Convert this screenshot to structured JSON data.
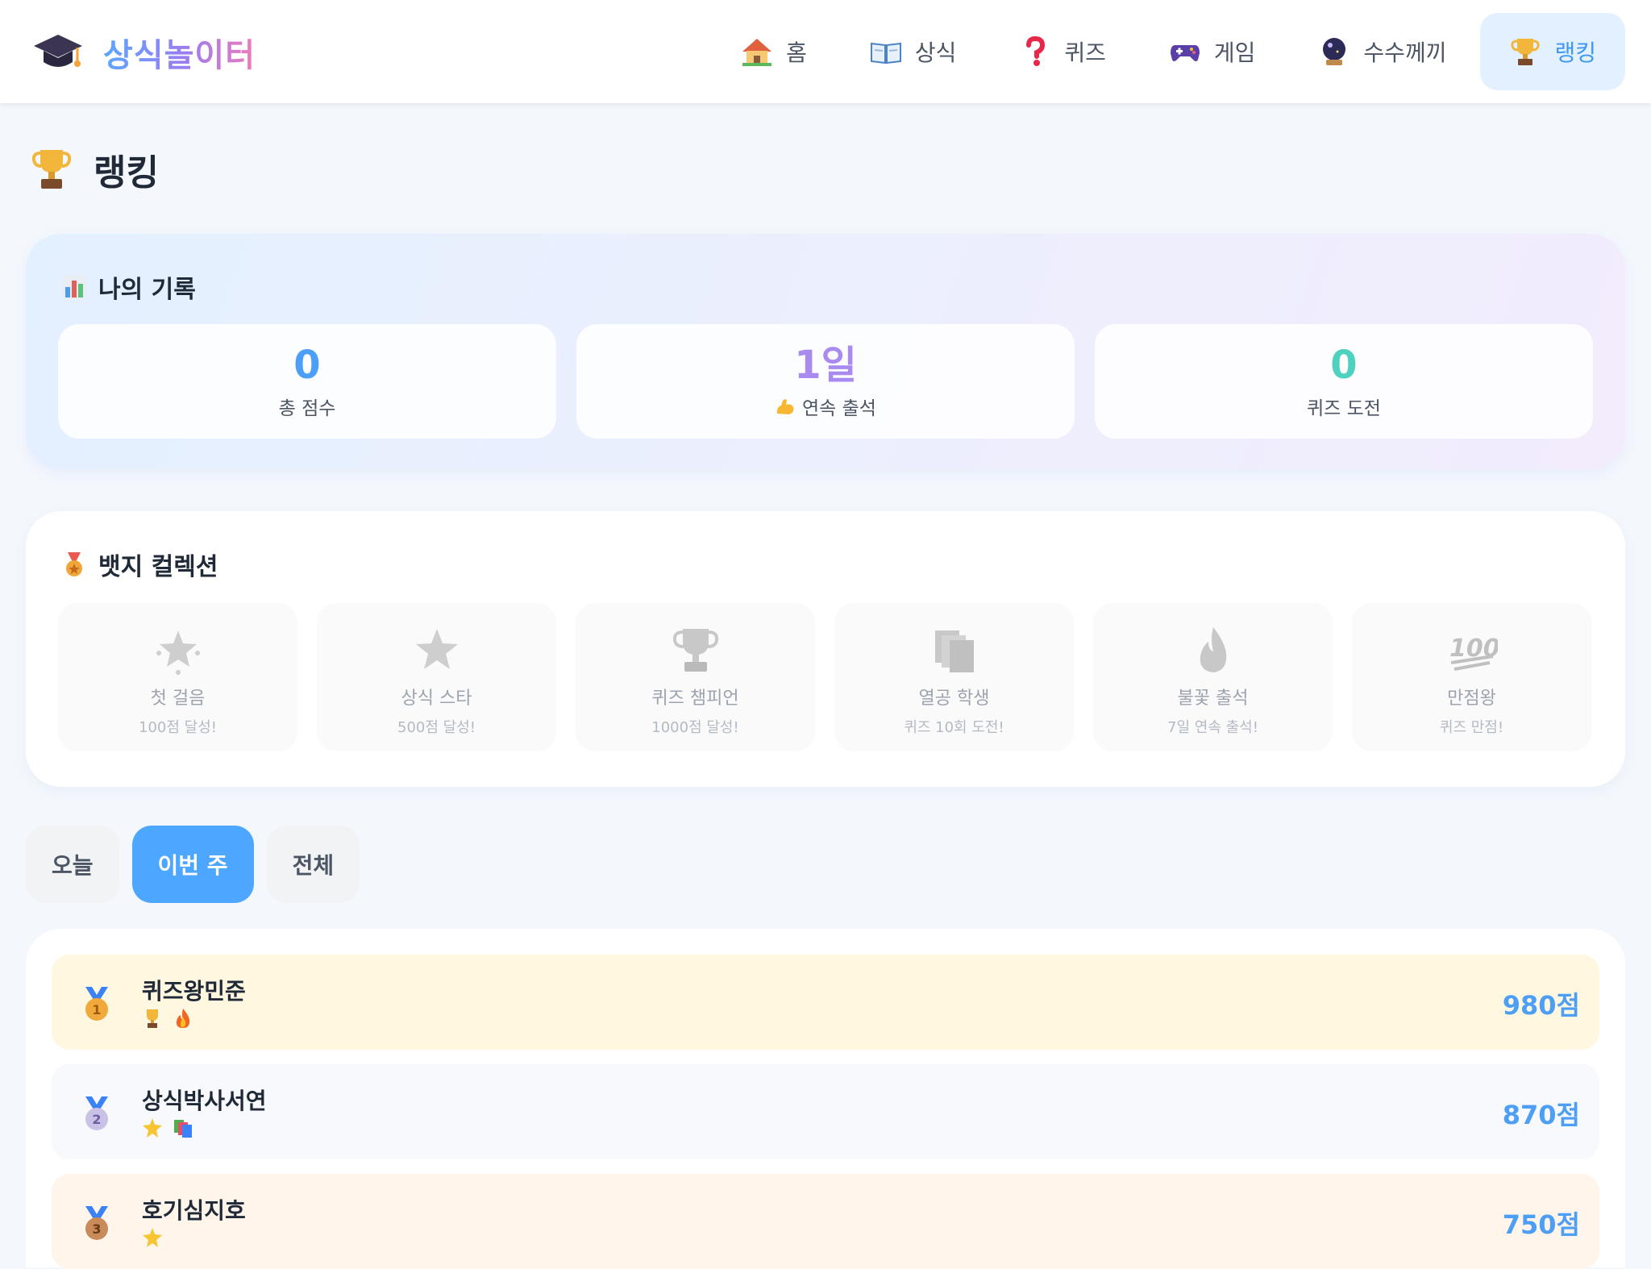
{
  "header": {
    "brand": "상식놀이터",
    "nav": [
      {
        "label": "홈",
        "icon": "house-icon"
      },
      {
        "label": "상식",
        "icon": "open-book-icon"
      },
      {
        "label": "퀴즈",
        "icon": "question-mark-icon"
      },
      {
        "label": "게임",
        "icon": "game-controller-icon"
      },
      {
        "label": "수수께끼",
        "icon": "crystal-ball-icon"
      },
      {
        "label": "랭킹",
        "icon": "trophy-icon",
        "active": true
      }
    ]
  },
  "page": {
    "title": "랭킹"
  },
  "record": {
    "title": "나의 기록",
    "stats": [
      {
        "value": "0",
        "label": "총 점수",
        "color": "#4d9ef5"
      },
      {
        "value": "1일",
        "label": "연속 출석",
        "color": "#a98af0",
        "icon": "flexed-biceps-icon"
      },
      {
        "value": "0",
        "label": "퀴즈 도전",
        "color": "#4fd1c0"
      }
    ]
  },
  "badges": {
    "title": "뱃지 컬렉션",
    "items": [
      {
        "name": "첫 걸음",
        "desc": "100점 달성!",
        "icon": "glowing-star-icon"
      },
      {
        "name": "상식 스타",
        "desc": "500점 달성!",
        "icon": "star-icon"
      },
      {
        "name": "퀴즈 챔피언",
        "desc": "1000점 달성!",
        "icon": "trophy-icon"
      },
      {
        "name": "열공 학생",
        "desc": "퀴즈 10회 도전!",
        "icon": "books-icon"
      },
      {
        "name": "불꽃 출석",
        "desc": "7일 연속 출석!",
        "icon": "fire-icon"
      },
      {
        "name": "만점왕",
        "desc": "퀴즈 만점!",
        "icon": "hundred-points-icon"
      }
    ]
  },
  "tabs": [
    {
      "label": "오늘"
    },
    {
      "label": "이번 주",
      "active": true
    },
    {
      "label": "전체"
    }
  ],
  "ranking": [
    {
      "rank": 1,
      "name": "퀴즈왕민준",
      "score": "980점",
      "badges": [
        "trophy-icon",
        "fire-icon"
      ],
      "bg": "#fff7e0"
    },
    {
      "rank": 2,
      "name": "상식박사서연",
      "score": "870점",
      "badges": [
        "star-icon",
        "books-icon"
      ],
      "bg": "#f7f9fc"
    },
    {
      "rank": 3,
      "name": "호기심지호",
      "score": "750점",
      "badges": [
        "star-icon"
      ],
      "bg": "#fff5ea"
    }
  ],
  "colors": {
    "accent": "#4da6ff",
    "active_nav_bg": "#e3f0ff",
    "score_text": "#4d9ef5"
  }
}
